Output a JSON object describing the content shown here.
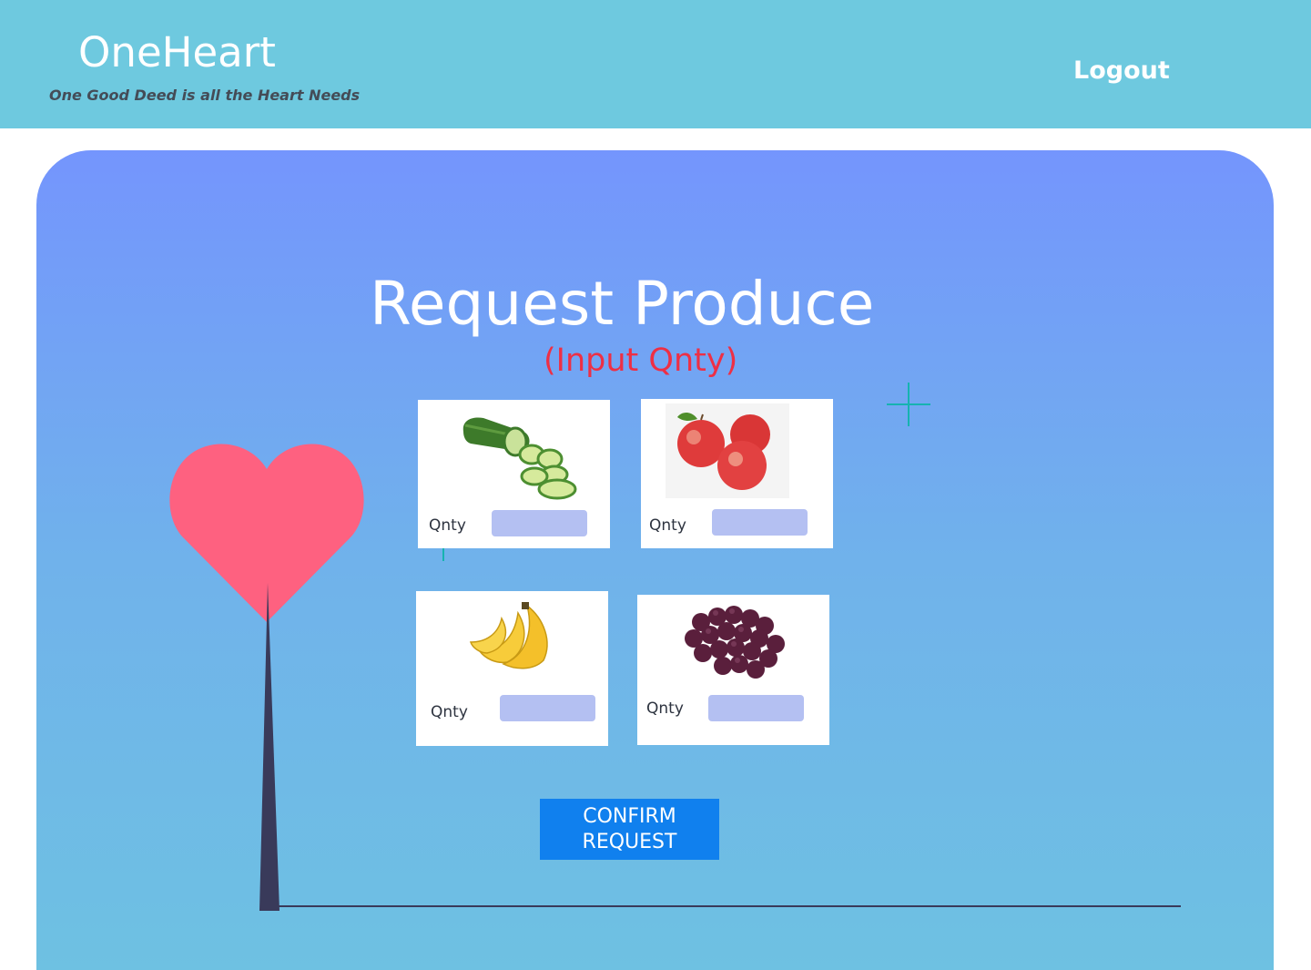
{
  "header": {
    "brand": "OneHeart",
    "tagline": "One Good Deed is all the Heart Needs",
    "logout_label": "Logout"
  },
  "main": {
    "title": "Request Produce",
    "subtitle": "(Input Qnty)",
    "items": [
      {
        "name": "cucumber",
        "qty_label": "Qnty",
        "qty_value": ""
      },
      {
        "name": "apples",
        "qty_label": "Qnty",
        "qty_value": ""
      },
      {
        "name": "bananas",
        "qty_label": "Qnty",
        "qty_value": ""
      },
      {
        "name": "grapes",
        "qty_label": "Qnty",
        "qty_value": ""
      }
    ],
    "confirm_label": "CONFIRM REQUEST"
  },
  "colors": {
    "header_bg": "#6ec9df",
    "panel_top": "#7495fd",
    "panel_bottom": "#6ec1e2",
    "subtitle": "#ee2f45",
    "heart": "#fe6180",
    "confirm_bg": "#1080ee",
    "qty_input": "#b4c0f2"
  }
}
